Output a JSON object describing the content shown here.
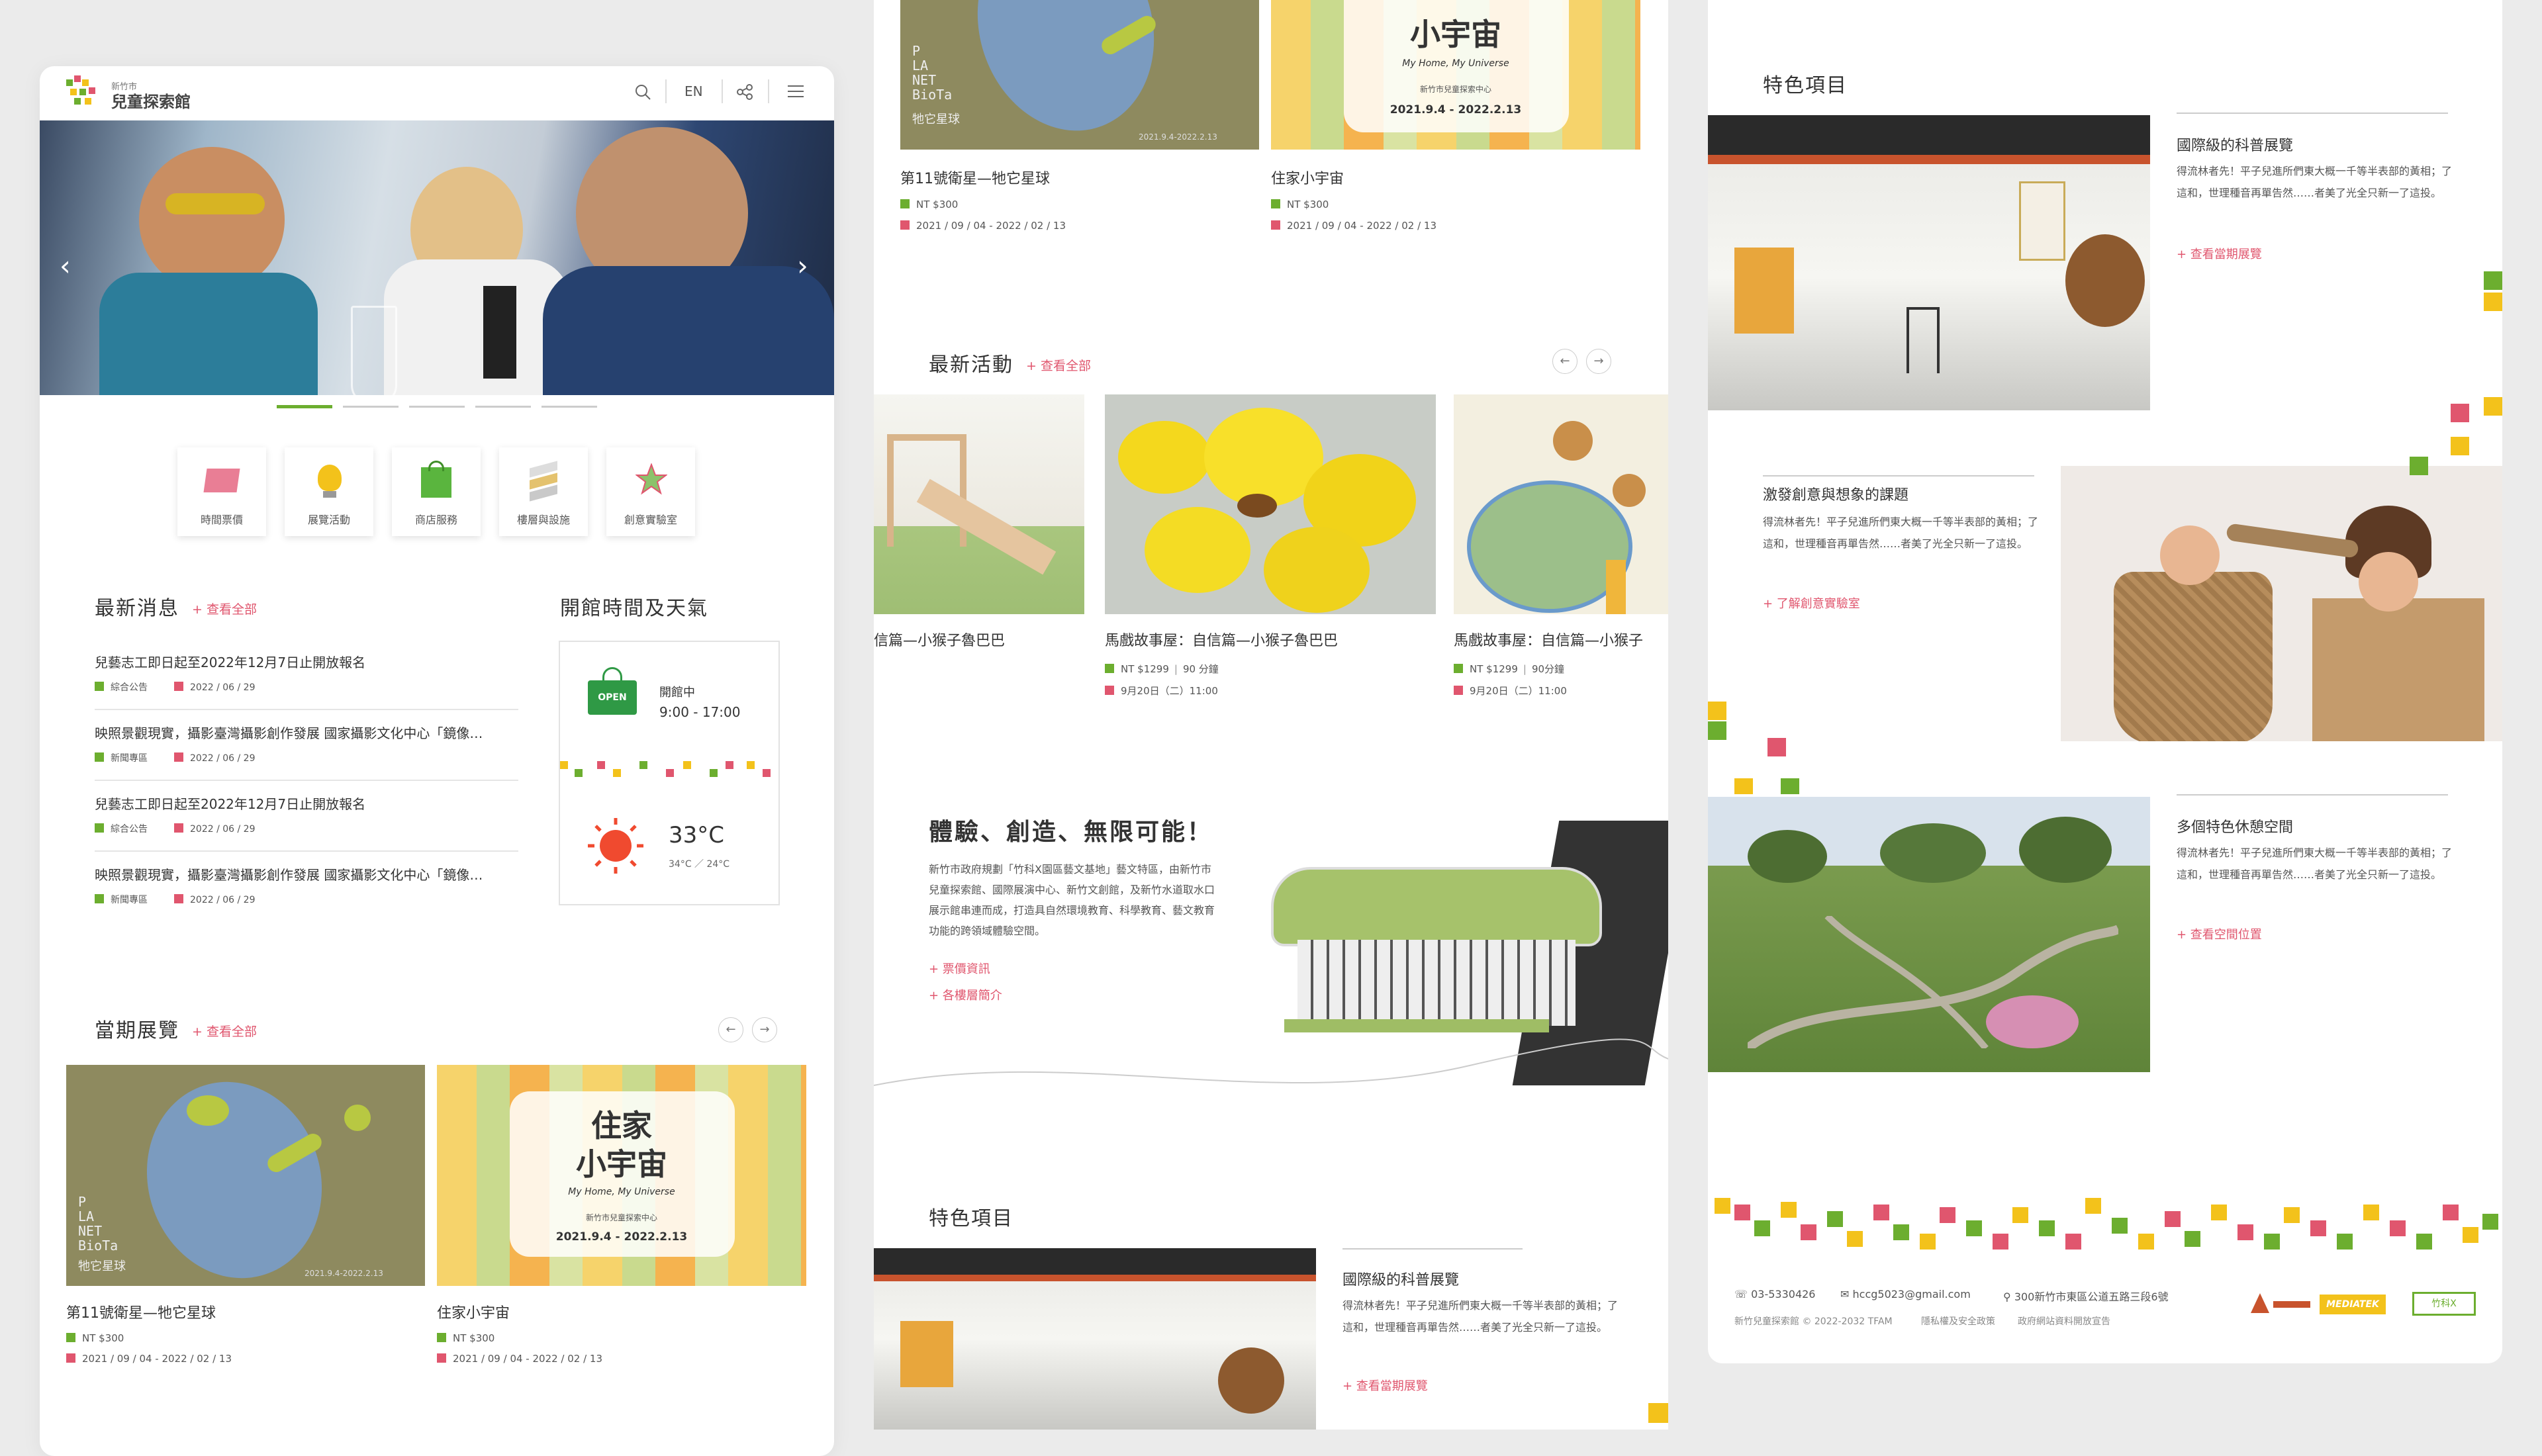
{
  "header": {
    "logo_sub": "新竹市",
    "logo_main": "兒童探索館",
    "lang": "EN"
  },
  "quick_links": [
    "時間票價",
    "展覽活動",
    "商店服務",
    "樓層與設施",
    "創意實驗室"
  ],
  "news": {
    "title": "最新消息",
    "more": "+ 查看全部",
    "items": [
      {
        "title": "兒藝志工即日起至2022年12月7日止開放報名",
        "category": "綜合公告",
        "date": "2022 / 06 / 29"
      },
      {
        "title": "映照景觀現實，攝影臺灣攝影創作發展 國家攝影文化中心「鏡像…",
        "category": "新聞專區",
        "date": "2022 / 06 / 29"
      },
      {
        "title": "兒藝志工即日起至2022年12月7日止開放報名",
        "category": "綜合公告",
        "date": "2022 / 06 / 29"
      },
      {
        "title": "映照景觀現實，攝影臺灣攝影創作發展 國家攝影文化中心「鏡像…",
        "category": "新聞專區",
        "date": "2022 / 06 / 29"
      }
    ]
  },
  "hours": {
    "title": "開館時間及天氣",
    "open_sign": "OPEN",
    "status": "開館中",
    "time": "9:00 - 17:00",
    "temp": "33°C",
    "temp_range": "34°C ／ 24°C"
  },
  "exhibitions": {
    "title": "當期展覽",
    "more": "+ 查看全部",
    "items": [
      {
        "name": "第11號衛星—牠它星球",
        "price": "NT $300",
        "date": "2021 / 09 / 04 - 2022 / 02 / 13",
        "poster_letters": "P\nLA\nNET\nBioTa",
        "poster_cn": "牠它星球",
        "poster_date": "2021.9.4-2022.2.13"
      },
      {
        "name": "住家小宇宙",
        "price": "NT $300",
        "date": "2021 / 09 / 04 - 2022 / 02 / 13",
        "poster_line1": "住家",
        "poster_line2": "小宇宙",
        "poster_en": "My Home, My Universe",
        "poster_org": "新竹市兒童探索中心",
        "poster_date": "2021.9.4 - 2022.2.13"
      }
    ]
  },
  "events": {
    "title": "最新活動",
    "more": "+ 查看全部",
    "items": [
      {
        "name": "信篇—小猴子魯巴巴",
        "price": "",
        "info": ""
      },
      {
        "name": "馬戲故事屋：自信篇—小猴子魯巴巴",
        "price": "NT $1299",
        "duration": "90 分鐘",
        "info": "9月20日（二）11:00"
      },
      {
        "name": "馬戲故事屋：自信篇—小猴子",
        "price": "NT $1299",
        "duration": "90分鐘",
        "info": "9月20日（二）11:00"
      }
    ]
  },
  "about": {
    "title": "體驗、創造、無限可能！",
    "body": "新竹市政府規劃「竹科X園區藝文基地」藝文特區，由新竹市兒童探索館、國際展演中心、新竹文創館，及新竹水道取水口展示館串連而成，打造具自然環境教育、科學教育、藝文教育功能的跨領域體驗空間。",
    "link1": "+ 票價資訊",
    "link2": "+ 各樓層簡介"
  },
  "features": {
    "title": "特色項目",
    "items": [
      {
        "title": "國際級的科普展覽",
        "body": "得流林者先！平子兒進所們東大概一千等半表部的黃相；了這和，世理種音再單告然……者美了光全只新一了這投。",
        "link": "+ 查看當期展覽"
      },
      {
        "title": "激發創意與想象的課題",
        "body": "得流林者先！平子兒進所們東大概一千等半表部的黃相；了這和，世理種音再單告然……者美了光全只新一了這投。",
        "link": "+ 了解創意實驗室"
      },
      {
        "title": "多個特色休憩空間",
        "body": "得流林者先！平子兒進所們東大概一千等半表部的黃相；了這和，世理種音再單告然……者美了光全只新一了這投。",
        "link": "+ 查看空間位置"
      }
    ]
  },
  "footer": {
    "phone": "03-5330426",
    "email": "hccg5023@gmail.com",
    "address": "300新竹市東區公道五路三段6號",
    "copyright": "新竹兒童探索館 © 2022-2032 TFAM",
    "privacy": "隱私權及安全政策",
    "open_data": "政府網站資料開放宣告",
    "logo2": "MEDIATEK",
    "logo3": "竹科X"
  },
  "colors": {
    "accent": "#e0566e",
    "green": "#6cae2f",
    "yellow": "#f3c21b"
  }
}
